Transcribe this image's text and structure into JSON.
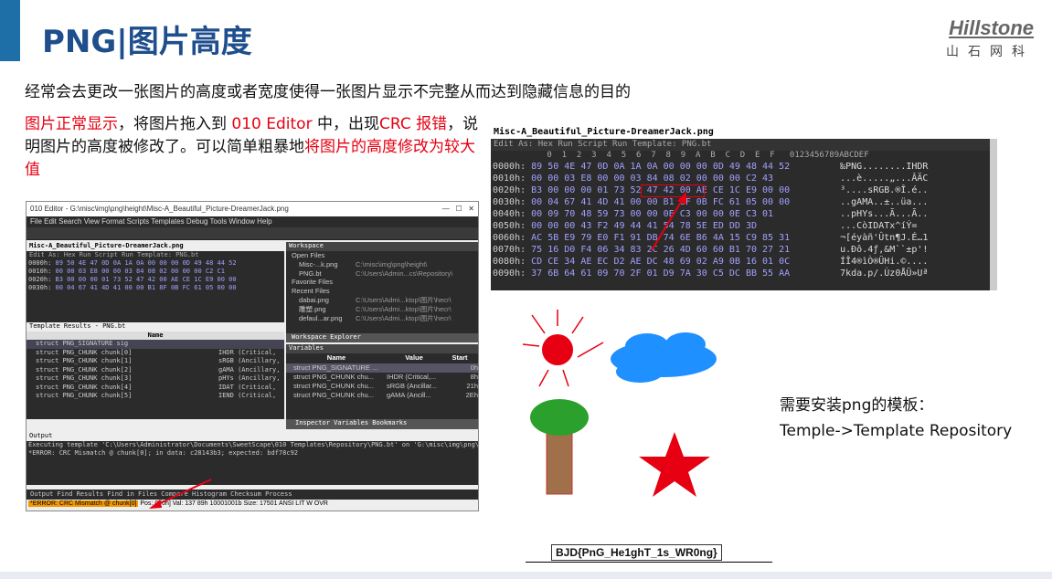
{
  "slide": {
    "title": "PNG|图片高度",
    "logo_name": "Hillstone",
    "logo_sub": "山石网科",
    "line1": "经常会去更改一张图片的高度或者宽度使得一张图片显示不完整从而达到隐藏信息的目的",
    "para_red1": "图片正常显示",
    "para_t1": "，将图片拖入到 ",
    "para_red2": "010 Editor",
    "para_t2": " 中，出现",
    "para_red3": "CRC 报错",
    "para_t3": "，说明图片的高度被修改了。可以简单粗暴地",
    "para_red4": "将图片的高度修改为较大值",
    "note1": "需要安装png的模板：",
    "note2": "Temple->Template Repository",
    "flag": "BJD{PnG_He1ghT_1s_WR0ng}"
  },
  "editor": {
    "window_title": "010 Editor - G:\\misc\\img\\png\\height\\Misc-A_Beautiful_Picture-DreamerJack.png",
    "menu": "File  Edit  Search  View  Format  Scripts  Templates  Debug  Tools  Window  Help",
    "tab": "Misc-A_Beautiful_Picture-DreamerJack.png",
    "tab_sub": "Edit As: Hex   Run Script   Run Template: PNG.bt",
    "hex_rows": [
      {
        "off": "0000h:",
        "bytes": " 89 50 4E 47 0D 0A 1A 0A 00 00 00 0D 49 48 44 52"
      },
      {
        "off": "0010h:",
        "bytes": " 00 00 03 E8 00 00 03 84 08 02 00 00 00 C2 C1"
      },
      {
        "off": "0020h:",
        "bytes": " B3 00 00 00 01 73 52 47 42 00 AE CE 1C E9 00 00"
      },
      {
        "off": "0030h:",
        "bytes": " 00 04 67 41 4D 41 00 00 B1 8F 0B FC 61 05 00 00"
      }
    ],
    "workspace_title": "Workspace",
    "workspace_items": [
      "Open Files",
      "Misc-...k.png",
      "PNG.bt",
      "Favorite Files",
      "Recent Files",
      "dabai.png",
      "雕塑.png",
      "defaul...ar.png"
    ],
    "workspace_paths": [
      "",
      "C:\\misc\\img\\png\\height\\",
      "C:\\Users\\Admin...cs\\Repository\\",
      "",
      "",
      "C:\\Users\\Admi...ktop\\图片\\hecr\\",
      "C:\\Users\\Admi...ktop\\图片\\hecr\\",
      "C:\\Users\\Admi...ktop\\图片\\hecr\\"
    ],
    "template_title": "Template Results - PNG.bt",
    "template_col": "Name",
    "template_rows": [
      {
        "name": "struct PNG_SIGNATURE sig",
        "value": ""
      },
      {
        "name": "struct PNG_CHUNK chunk[0]",
        "value": "IHDR  (Critical,"
      },
      {
        "name": "struct PNG_CHUNK chunk[1]",
        "value": "sRGB  (Ancillary,"
      },
      {
        "name": "struct PNG_CHUNK chunk[2]",
        "value": "gAMA  (Ancillary,"
      },
      {
        "name": "struct PNG_CHUNK chunk[3]",
        "value": "pHYs  (Ancillary,"
      },
      {
        "name": "struct PNG_CHUNK chunk[4]",
        "value": "IDAT  (Critical,"
      },
      {
        "name": "struct PNG_CHUNK chunk[5]",
        "value": "IEND  (Critical,"
      }
    ],
    "vars_title": "Variables",
    "vars_cols": [
      "Name",
      "Value",
      "Start"
    ],
    "vars_rows": [
      {
        "n": "struct PNG_SIGNATURE ...",
        "v": "",
        "s": "0h"
      },
      {
        "n": "struct PNG_CHUNK chu...",
        "v": "IHDR (Critical,...",
        "s": "8h"
      },
      {
        "n": "struct PNG_CHUNK chu...",
        "v": "sRGB (Ancillar...",
        "s": "21h"
      },
      {
        "n": "struct PNG_CHUNK chu...",
        "v": "gAMA (Ancill...",
        "s": "2Eh"
      }
    ],
    "ws_tabs": "Workspace   Explorer",
    "inspector_tabs": "Inspector   Variables   Bookmarks",
    "output_title": "Output",
    "output_line1": "Executing template 'C:\\Users\\Administrator\\Documents\\SweetScape\\010 Templates\\Repository\\PNG.bt' on 'G:\\misc\\img\\png\\height",
    "output_line2": "*ERROR: CRC Mismatch @ chunk[0]; in data: c28143b3; expected: bdf78c92",
    "bottom_tabs": "Output   Find Results   Find in Files   Compare   Histogram   Checksum   Process",
    "status_err": "*ERROR: CRC Mismatch @ chunk[0]",
    "status_rest": " Pos: 0 [0h]          Val: 137 89h 10001001b  Size: 17501  ANSI        LIT  W  OVR"
  },
  "hexview": {
    "tab": "Misc-A_Beautiful_Picture-DreamerJack.png",
    "sub": "Edit As: Hex   Run Script   Run Template: PNG.bt",
    "cols": " 0  1  2  3  4  5  6  7  8  9  A  B  C  D  E  F   0123456789ABCDEF",
    "rows": [
      {
        "o": "0000h:",
        "b": " 89 50 4E 47 0D 0A 1A 0A 00 00 00 0D 49 48 44 52",
        "a": "‰PNG........IHDR"
      },
      {
        "o": "0010h:",
        "b": " 00 00 03 E8 00 00 03 84 08 02 00 00 00 C2 43",
        "a": "...è.....„...ÂÄC"
      },
      {
        "o": "0020h:",
        "b": " B3 00 00 00 01 73 52 47 42 00 AE CE 1C E9 00 00",
        "a": "³....sRGB.®Î.é.."
      },
      {
        "o": "0030h:",
        "b": " 00 04 67 41 4D 41 00 00 B1 8F 0B FC 61 05 00 00",
        "a": "..gAMA..±..üa..."
      },
      {
        "o": "0040h:",
        "b": " 00 09 70 48 59 73 00 00 0E C3 00 00 0E C3 01",
        "a": "..pHYs...Ã...Ã.."
      },
      {
        "o": "0050h:",
        "b": " 00 00 00 43 F2 49 44 41 54 78 5E ED DD 3D",
        "a": "...CòIDATx^íÝ="
      },
      {
        "o": "0060h:",
        "b": " AC 5B E9 79 E0 F1 91 DB 74 6E B6 4A 15 C9 85 31",
        "a": "¬[éyàñ'Ûtn¶J.É…1"
      },
      {
        "o": "0070h:",
        "b": " 75 16 D0 F4 06 34 83 2C 26 4D 60 60 B1 70 27 21",
        "a": "u.Ðô.4ƒ,&M``±p'!"
      },
      {
        "o": "0080h:",
        "b": " CD CE 34 AE EC D2 AE DC 48 69 02 A9 0B 16 01 0C",
        "a": "ÍÎ4®ìÒ®ÜHi.©...."
      },
      {
        "o": "0090h:",
        "b": " 37 6B 64 61 09 70 2F 01 D9 7A 30 C5 DC BB 55 AA",
        "a": "7kda.p/.Ùz0ÅÜ»Uª"
      }
    ]
  },
  "colors": {
    "accent": "#1e6fa8",
    "title": "#1f4e8c",
    "red": "#e60012",
    "sun": "#e60012",
    "cloud": "#1e90ff",
    "tree": "#2ca02c",
    "trunk": "#a0704a",
    "star": "#e60012"
  }
}
